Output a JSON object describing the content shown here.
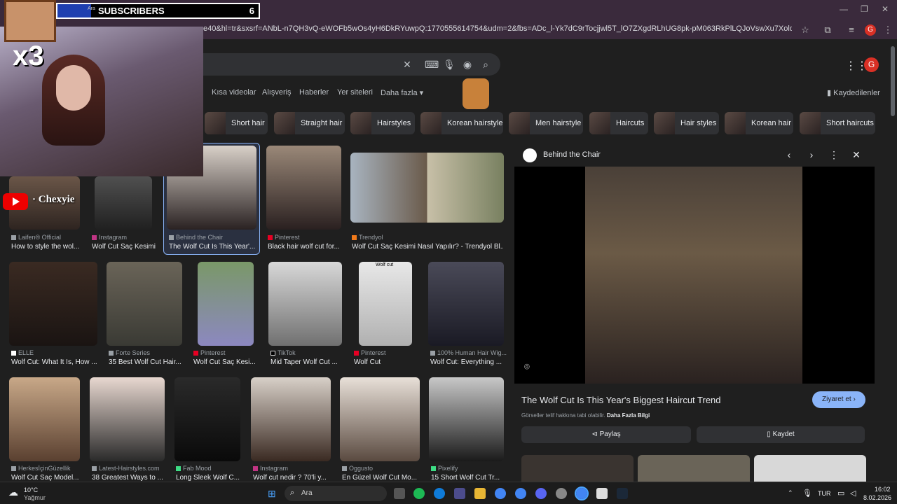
{
  "window": {
    "title": ""
  },
  "address": {
    "url": "e40&hl=tr&sxsrf=ANbL-n7QH3vQ-eWOFb5wOs4yH6DkRYuwpQ:1770555614754&udm=2&fbs=ADc_l-Yk7dC9rTocjjwl5T_lO7ZXgdRLhUG8pk-pM063RkPlLQJoVswXu7Xoldd5UH6fMIoUDtgozPElNwZYSjs_..."
  },
  "nav": {
    "tabs": [
      "Kısa videolar",
      "Alışveriş",
      "Haberler",
      "Yer siteleri",
      "Daha fazla ▾"
    ],
    "saved": "Kaydedilenler",
    "avatar_letter": "G"
  },
  "chips": [
    "Short hair",
    "Straight hair",
    "Hairstyles",
    "Korean hairstyle",
    "Men hairstyle",
    "Haircuts",
    "Hair styles",
    "Korean hair",
    "Short haircuts"
  ],
  "results": {
    "row1": [
      {
        "source": "Laifen® Official",
        "title": "How to style the wol..."
      },
      {
        "source": "Instagram",
        "title": "Wolf Cut Saç Kesimi"
      },
      {
        "source": "Behind the Chair",
        "title": "The Wolf Cut Is This Year'..."
      },
      {
        "source": "Pinterest",
        "title": "Black hair wolf cut for..."
      },
      {
        "source": "Trendyol",
        "title": "Wolf Cut Saç Kesimi Nasıl Yapılır? - Trendyol Bl..."
      }
    ],
    "row2": [
      {
        "source": "ELLE",
        "title": "Wolf Cut: What It Is, How ..."
      },
      {
        "source": "Forte Series",
        "title": "35 Best Wolf Cut Hair..."
      },
      {
        "source": "Pinterest",
        "title": "Wolf Cut Saç Kesi..."
      },
      {
        "source": "TikTok",
        "title": "Mid Taper Wolf Cut ..."
      },
      {
        "source": "Pinterest",
        "title": "Wolf Cut"
      },
      {
        "source": "100% Human Hair Wig...",
        "title": "Wolf Cut: Everything ..."
      }
    ],
    "row3": [
      {
        "source": "HerkesİçinGüzellik",
        "title": "Wolf Cut Saç Model..."
      },
      {
        "source": "Latest-Hairstyles.com",
        "title": "38 Greatest Ways to ..."
      },
      {
        "source": "Fab Mood",
        "title": "Long Sleek Wolf C..."
      },
      {
        "source": "Instagram",
        "title": "Wolf cut nedir ? 70'li y..."
      },
      {
        "source": "Oggusto",
        "title": "En Güzel Wolf Cut Mo..."
      },
      {
        "source": "Pixelify",
        "title": "15 Short Wolf Cut Tr..."
      }
    ],
    "wolfcut_label": "Wolf cut"
  },
  "panel": {
    "source": "Behind the Chair",
    "title": "The Wolf Cut Is This Year's Biggest Haircut Trend",
    "visit": "Ziyaret et ›",
    "copyright": "Görseller telif hakkına tabi olabilir.",
    "more_info": "Daha Fazla Bilgi",
    "share": "Paylaş",
    "save": "Kaydet"
  },
  "taskbar": {
    "weather_temp": "10°C",
    "weather_desc": "Yağmur",
    "search": "Ara",
    "lang": "TUR",
    "time": "16:02",
    "date": "8.02.2026"
  },
  "overlay": {
    "subscribers_label": "SUBSCRIBERS",
    "subscribers_count": "6",
    "blue_text": "Ara",
    "multiplier": "x3",
    "channel": "· Chexyie"
  },
  "colors": {
    "accent": "#8ab4f8",
    "profile": "#d93025",
    "background": "#1f1f1f"
  }
}
